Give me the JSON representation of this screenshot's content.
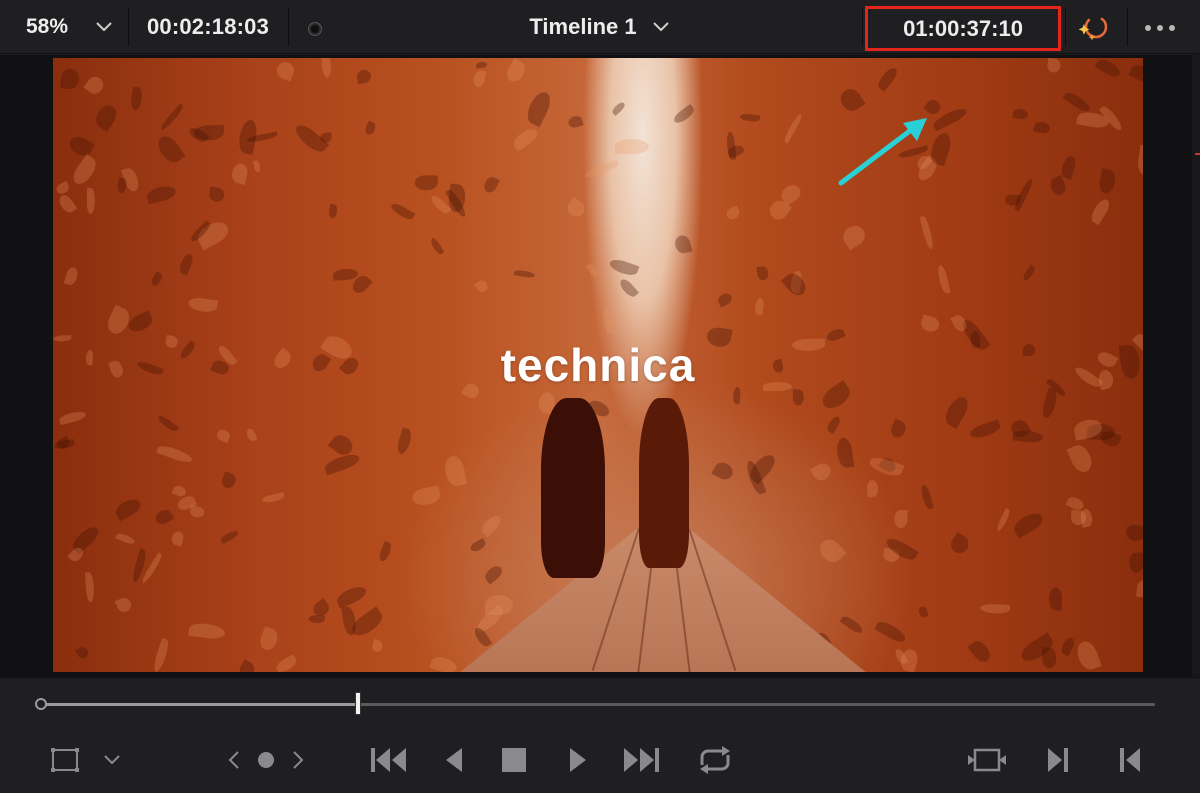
{
  "topbar": {
    "zoom_label": "58%",
    "duration": "00:02:18:03",
    "timeline_name": "Timeline 1",
    "timecode": "01:00:37:10",
    "zoom_icon": "chevron-down-icon",
    "timeline_icon": "chevron-down-icon",
    "fx_icon": "magic-sparkle-icon",
    "more_icon": "ellipsis-icon"
  },
  "viewer": {
    "overlay_text": "technica",
    "annotation_color": "#e3251c",
    "arrow_color": "#2ad0d8"
  },
  "scrubber": {
    "playhead_position": 0.285
  },
  "transport": {
    "left_tools": [
      "safe-area-frame-icon",
      "chevron-down-icon"
    ],
    "clip_nav": [
      "chevron-left-icon",
      "dot-marker-icon",
      "chevron-right-icon"
    ],
    "controls": [
      "jump-to-start-icon",
      "play-reverse-icon",
      "stop-icon",
      "play-icon",
      "jump-to-end-icon",
      "loop-icon"
    ],
    "right_tools": [
      "match-frame-icon",
      "mark-in-icon",
      "mark-out-icon"
    ]
  }
}
